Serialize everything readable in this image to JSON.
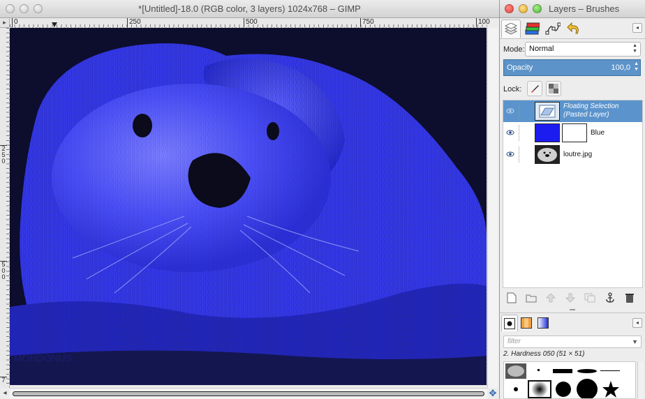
{
  "image_window": {
    "title": "*[Untitled]-18.0 (RGB color, 3 layers) 1024x768 – GIMP",
    "ruler_labels": [
      "0",
      "250",
      "500",
      "750",
      "100"
    ],
    "vruler_labels": [
      "2 5 0",
      "5 0 0",
      "7"
    ],
    "canvas_colors": {
      "background": "#0d0d2e",
      "fur": "#3a3ef0",
      "fur_light": "#6f72ff",
      "nose": "#0b0b1c"
    },
    "watermark": "MONDONUS"
  },
  "dock": {
    "title": "Layers – Brushes",
    "tabs": [
      {
        "name": "layers-tab",
        "icon": "layers-icon"
      },
      {
        "name": "channels-tab",
        "icon": "channels-icon"
      },
      {
        "name": "paths-tab",
        "icon": "paths-icon"
      },
      {
        "name": "undo-tab",
        "icon": "undo-icon"
      }
    ],
    "mode_label": "Mode:",
    "mode_value": "Normal",
    "opacity_label": "Opacity",
    "opacity_value": "100,0",
    "lock_label": "Lock:",
    "layers": [
      {
        "name_line1": "Floating Selection",
        "name_line2": "(Pasted Layer)",
        "selected": true,
        "visible": false
      },
      {
        "name_line1": "Blue",
        "name_line2": "",
        "selected": false,
        "visible": true
      },
      {
        "name_line1": "loutre.jpg",
        "name_line2": "",
        "selected": false,
        "visible": true
      }
    ],
    "brush_filter_placeholder": "filter",
    "brush_name": "2. Hardness 050 (51 × 51)",
    "accent_color": "#5b94cc"
  }
}
